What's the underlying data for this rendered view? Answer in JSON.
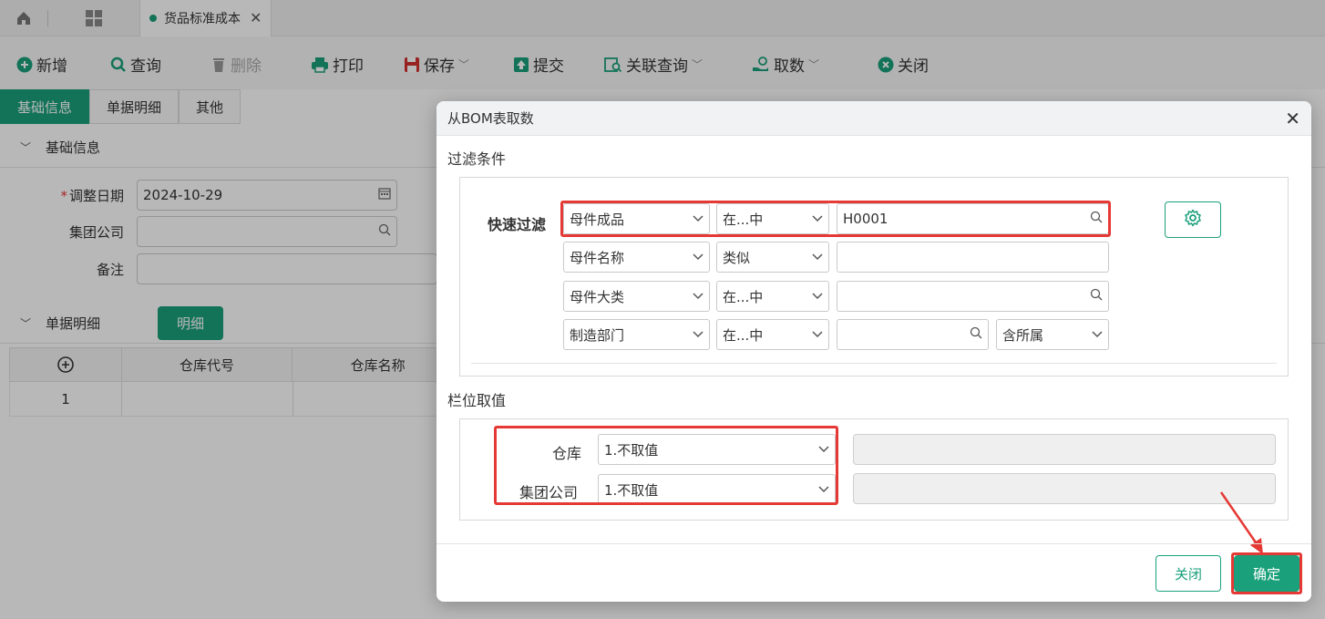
{
  "tabbar": {
    "doc_tab_label": "货品标准成本"
  },
  "toolbar": {
    "new": "新增",
    "query": "查询",
    "delete": "删除",
    "print": "打印",
    "save": "保存",
    "submit": "提交",
    "related_query": "关联查询",
    "fetch": "取数",
    "close": "关闭"
  },
  "subtabs": [
    "基础信息",
    "单据明细",
    "其他"
  ],
  "basic_section": {
    "title": "基础信息",
    "adjust_date_label": "调整日期",
    "adjust_date_value": "2024-10-29",
    "group_company_label": "集团公司",
    "remark_label": "备注"
  },
  "detail_section": {
    "title": "单据明细",
    "detail_button": "明细"
  },
  "grid": {
    "col_code": "仓库代号",
    "col_name": "仓库名称",
    "row_no": "1"
  },
  "dialog": {
    "title": "从BOM表取数",
    "filter_section": "过滤条件",
    "quick_filter_label": "快速过滤",
    "filters": [
      {
        "field": "母件成品",
        "op": "在...中",
        "value": "H0001"
      },
      {
        "field": "母件名称",
        "op": "类似",
        "value": ""
      },
      {
        "field": "母件大类",
        "op": "在...中",
        "value": ""
      },
      {
        "field": "制造部门",
        "op": "在...中",
        "value": "",
        "extra": "含所属"
      }
    ],
    "column_section": "栏位取值",
    "columns": [
      {
        "label": "仓库",
        "value": "1.不取值"
      },
      {
        "label": "集团公司",
        "value": "1.不取值"
      }
    ],
    "close_button": "关闭",
    "confirm_button": "确定"
  },
  "colors": {
    "accent": "#1aa07a",
    "highlight": "#e53935"
  }
}
